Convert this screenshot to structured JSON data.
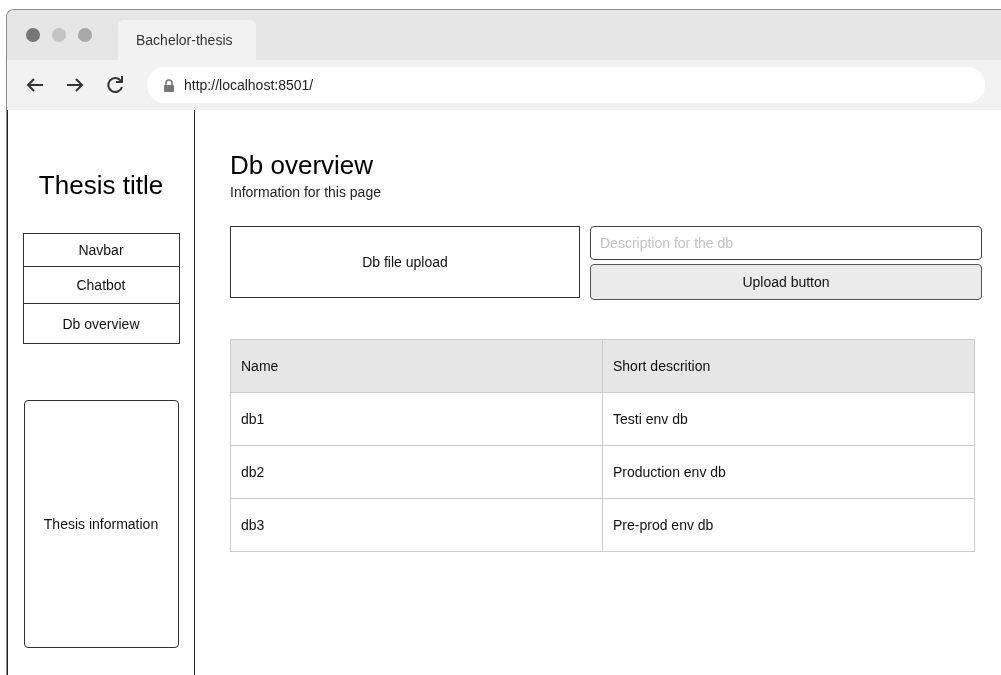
{
  "browser": {
    "tab": "Bachelor-thesis",
    "url": "http://localhost:8501/"
  },
  "sidebar": {
    "title": "Thesis title",
    "nav": [
      {
        "label": "Navbar"
      },
      {
        "label": "Chatbot"
      },
      {
        "label": "Db overview"
      }
    ],
    "info": "Thesis information"
  },
  "main": {
    "title": "Db overview",
    "subtitle": "Information for this page",
    "upload": "Db file upload",
    "description": {
      "placeholder": "Description for the db"
    },
    "button": "Upload button",
    "table": {
      "columns": [
        "Name",
        "Short descrition"
      ],
      "rows": [
        [
          "db1",
          "Testi env db"
        ],
        [
          "db2",
          "Production env db"
        ],
        [
          "db3",
          "Pre-prod env db"
        ]
      ]
    }
  }
}
